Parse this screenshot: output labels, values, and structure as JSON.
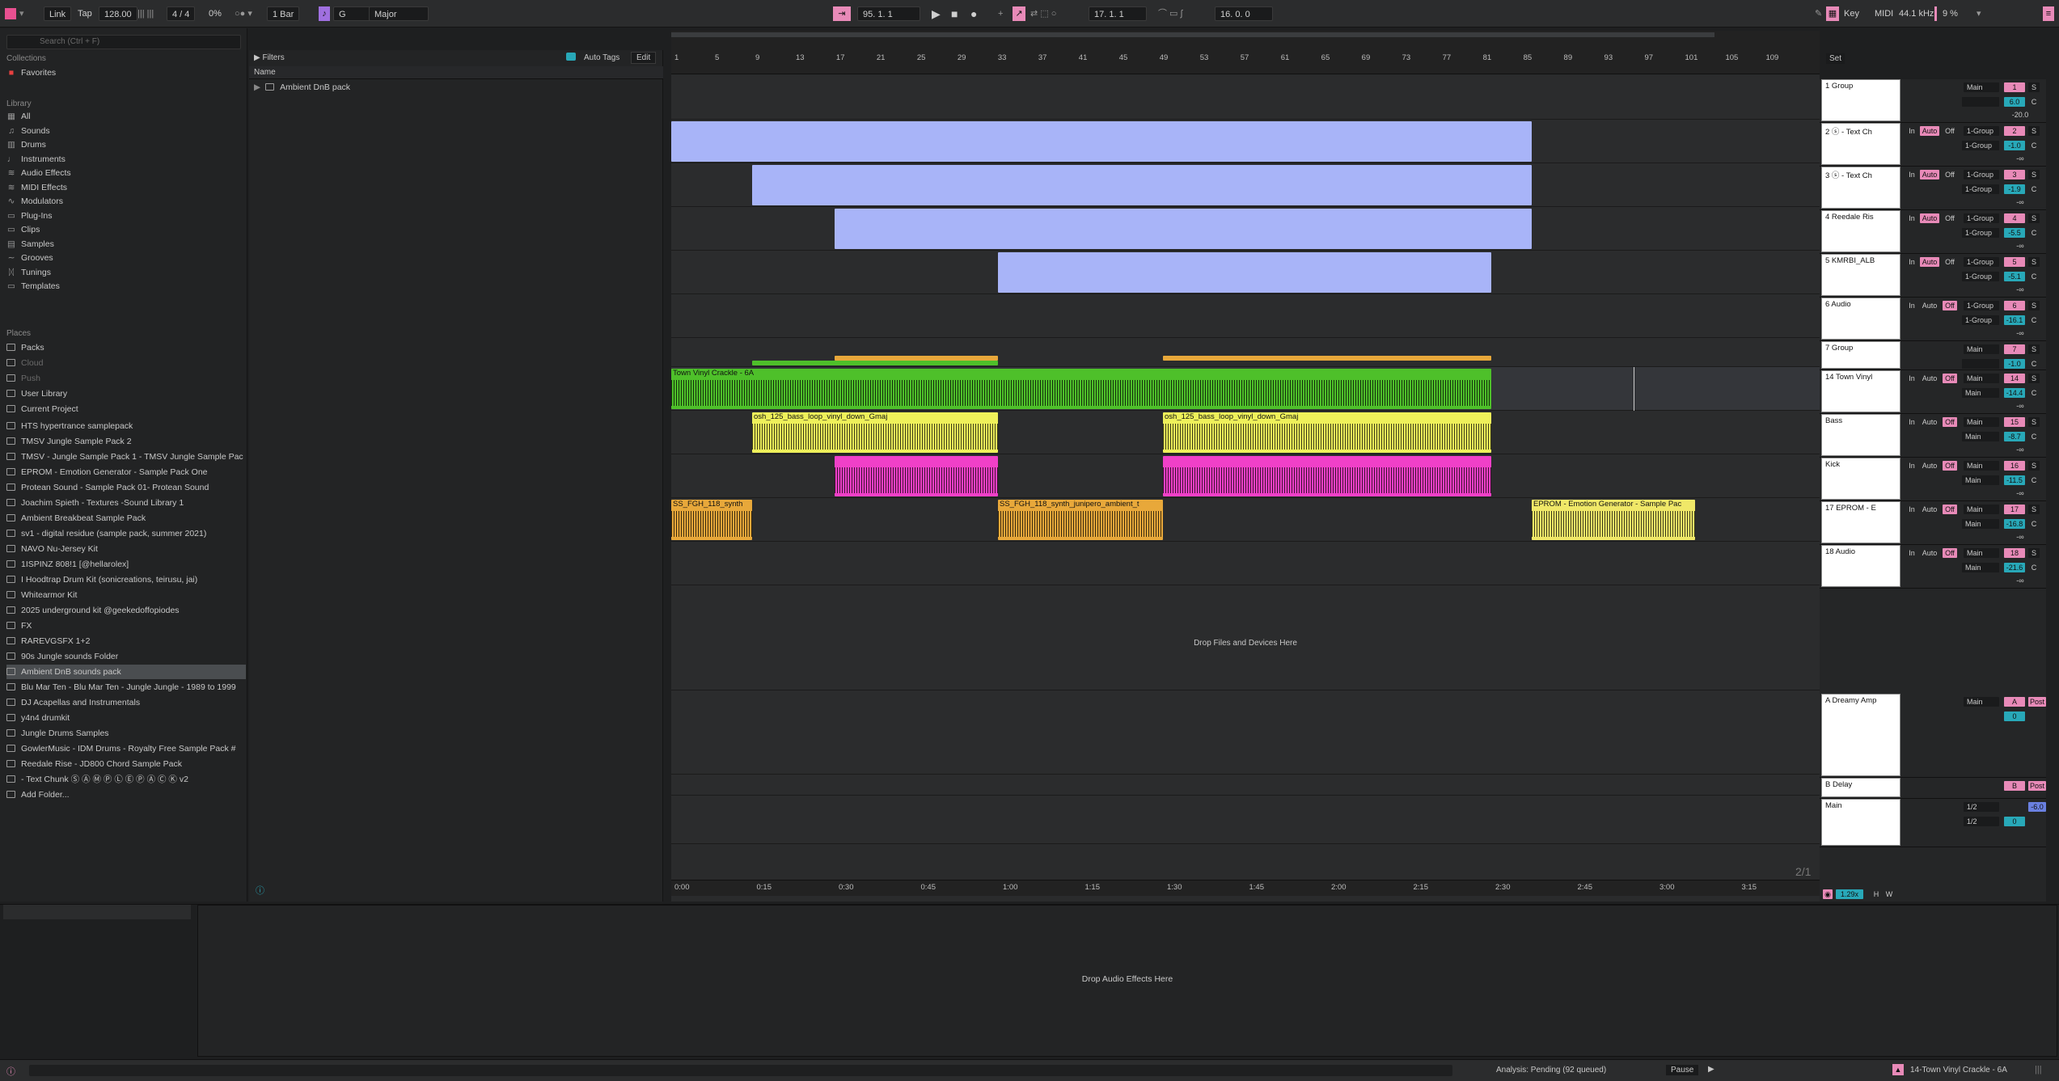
{
  "transport": {
    "link": "Link",
    "tap": "Tap",
    "tempo": "128.00",
    "signature": "4 / 4",
    "cpu_pct": "0%",
    "quant": "1 Bar",
    "key": "G",
    "scale": "Major",
    "position": "95.  1.  1",
    "loop_start": "17.  1.  1",
    "loop_len": "16.  0.  0",
    "key_label": "Key",
    "midi_label": "MIDI",
    "sample_rate": "44.1 kHz",
    "cpu": "9 %"
  },
  "browser": {
    "search_placeholder": "Search (Ctrl + F)",
    "collections_header": "Collections",
    "favorites": "Favorites",
    "library_header": "Library",
    "library": [
      "All",
      "Sounds",
      "Drums",
      "Instruments",
      "Audio Effects",
      "MIDI Effects",
      "Modulators",
      "Plug-Ins",
      "Clips",
      "Samples",
      "Grooves",
      "Tunings",
      "Templates"
    ],
    "places_header": "Places",
    "places": [
      "Packs",
      "Cloud",
      "Push",
      "User Library",
      "Current Project"
    ],
    "folders": [
      "HTS hypertrance samplepack",
      "TMSV Jungle Sample Pack 2",
      "TMSV - Jungle Sample Pack 1 - TMSV Jungle Sample Pac",
      "EPROM - Emotion Generator - Sample Pack One",
      "Protean Sound - Sample Pack 01- Protean Sound",
      "Joachim Spieth - Textures -Sound Library 1",
      "Ambient Breakbeat Sample Pack",
      "sv1 - digital residue (sample pack, summer 2021)",
      "NAVO Nu-Jersey Kit",
      "1ISPINZ 808!1 [@hellarolex]",
      "I Hoodtrap Drum Kit (sonicreations, teirusu, jai)",
      "Whitearmor Kit",
      "2025 underground kit @geekedoffopiodes",
      "FX",
      "RAREVGSFX 1+2",
      "90s Jungle sounds Folder",
      "Ambient DnB sounds pack",
      "Blu Mar Ten - Blu Mar Ten - Jungle Jungle - 1989 to 1999",
      "DJ Acapellas and Instrumentals",
      "y4n4 drumkit",
      "Jungle Drums Samples",
      "GowlerMusic - IDM Drums - Royalty Free Sample Pack #",
      "Reedale Rise - JD800 Chord Sample Pack",
      "- Text Chunk Ⓢ Ⓐ Ⓜ Ⓟ Ⓛ Ⓔ Ⓟ Ⓐ Ⓒ Ⓚ v2",
      "Add Folder..."
    ],
    "filters": "Filters",
    "auto_tags": "Auto Tags",
    "edit": "Edit",
    "name_col": "Name",
    "content": [
      "Ambient DnB pack"
    ]
  },
  "arrangement": {
    "bars": [
      "1",
      "5",
      "9",
      "13",
      "17",
      "21",
      "25",
      "29",
      "33",
      "37",
      "41",
      "45",
      "49",
      "53",
      "57",
      "61",
      "65",
      "69",
      "73",
      "77",
      "81",
      "85",
      "89",
      "93",
      "97",
      "101",
      "105",
      "109"
    ],
    "times": [
      "0:00",
      "0:15",
      "0:30",
      "0:45",
      "1:00",
      "1:15",
      "1:30",
      "1:45",
      "2:00",
      "2:15",
      "2:30",
      "2:45",
      "3:00",
      "3:15"
    ],
    "drop_files": "Drop Files and Devices Here",
    "page": "2/1",
    "set": "Set",
    "clips": {
      "vinyl": "Town Vinyl Crackle - 6A",
      "vinyl_short": "Town Vinyl",
      "bass": "osh_125_bass_loop_vinyl_down_Gmaj",
      "ss1": "SS_FGH_118_synth",
      "ss2": "SS_FGH_118_synth_junipero_ambient_t",
      "eprom": "EPROM - Emotion Generator - Sample Pac"
    }
  },
  "tracks": [
    {
      "name": "1 Group",
      "out": "Main",
      "num": "1",
      "vol": "6.0",
      "pan": "C",
      "send": "-20.0"
    },
    {
      "name": "2 ⓢ - Text Ch",
      "out": "1-Group",
      "num": "2",
      "vol": "-1.0",
      "pan": "C",
      "send": "-∞"
    },
    {
      "name": "3 ⓢ - Text Ch",
      "out": "1-Group",
      "num": "3",
      "vol": "-1.9",
      "pan": "C",
      "send": "-∞"
    },
    {
      "name": "4 Reedale Ris",
      "out": "1-Group",
      "num": "4",
      "vol": "-5.5",
      "pan": "C",
      "send": "-∞"
    },
    {
      "name": "5 KMRBI_ALB",
      "out": "1-Group",
      "num": "5",
      "vol": "-5.1",
      "pan": "C",
      "send": "-∞"
    },
    {
      "name": "6 Audio",
      "out": "1-Group",
      "num": "6",
      "vol": "-16.1",
      "pan": "C",
      "send": "-∞"
    },
    {
      "name": "7 Group",
      "out": "Main",
      "num": "7",
      "vol": "-1.0",
      "pan": "C",
      "send": ""
    },
    {
      "name": "14 Town Vinyl",
      "out": "Main",
      "num": "14",
      "vol": "-14.4",
      "pan": "C",
      "send": "-∞"
    },
    {
      "name": "Bass",
      "out": "Main",
      "num": "15",
      "vol": "-8.7",
      "pan": "C",
      "send": "-∞"
    },
    {
      "name": "Kick",
      "out": "Main",
      "num": "16",
      "vol": "-11.5",
      "pan": "C",
      "send": "-∞"
    },
    {
      "name": "17 EPROM - E",
      "out": "Main",
      "num": "17",
      "vol": "-16.8",
      "pan": "C",
      "send": "-∞"
    },
    {
      "name": "18 Audio",
      "out": "Main",
      "num": "18",
      "vol": "-21.6",
      "pan": "C",
      "send": "-∞"
    }
  ],
  "returns": [
    {
      "name": "A Dreamy Amp",
      "out": "Main",
      "num": "A",
      "vol": "0",
      "post": "Post"
    },
    {
      "name": "B Delay",
      "num": "B",
      "post": "Post"
    },
    {
      "name": "Main",
      "out": "1/2",
      "out2": "1/2",
      "vol": "0",
      "vol2": "-6.0"
    }
  ],
  "labels": {
    "in": "In",
    "auto": "Auto",
    "off": "Off",
    "s": "S",
    "c": "C",
    "h": "H",
    "w": "W",
    "zoom": "1.29x"
  },
  "bottom": {
    "drop_effects": "Drop Audio Effects Here"
  },
  "status": {
    "analysis": "Analysis: Pending (92 queued)",
    "pause": "Pause",
    "current": "14-Town Vinyl Crackle - 6A"
  },
  "colors": {
    "blue": "#a8b4f8",
    "green": "#4ec02a",
    "yellow": "#eef05a",
    "magenta": "#f040c8",
    "orange": "#e8a83a",
    "pink": "#e88ab8",
    "teal": "#28a8b8"
  }
}
